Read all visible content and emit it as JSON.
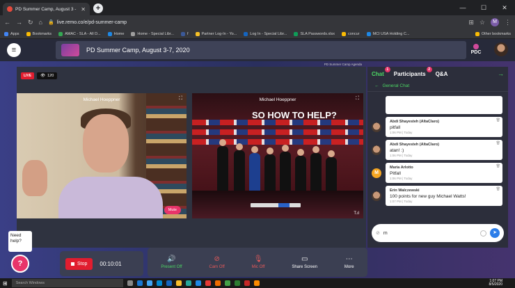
{
  "browser": {
    "tab_title": "PD Summer Camp, August 3 -",
    "url": "live.remo.co/e/pd-summer-camp",
    "bookmarks": [
      "Apps",
      "Bookmarks",
      "AMAC - SLA - All D...",
      "Home",
      "Home - Special Libr...",
      "f",
      "Partner Log-In - Yo...",
      "Log In - Special Libr...",
      "SLA Passwords.xlsx",
      "concur",
      "MCI USA Holding C..."
    ],
    "other_bookmarks": "Other bookmarks",
    "profile_initial": "M"
  },
  "header": {
    "event_title": "PD Summer Camp, August 3-7, 2020",
    "logo_text": "PDC",
    "agenda_label": "PD Summer Camp Agenda"
  },
  "stage": {
    "live_label": "LIVE",
    "viewer_count": "120",
    "tiles": [
      {
        "name": "Michael Hoeppner",
        "mute_label": "Mute"
      },
      {
        "name": "Michael Hoeppner",
        "slide_text": "SO HOW TO HELP?"
      }
    ]
  },
  "chat": {
    "tabs": [
      {
        "label": "Chat",
        "badge": "1"
      },
      {
        "label": "Participants",
        "badge": "2"
      },
      {
        "label": "Q&A",
        "badge": ""
      }
    ],
    "room": "General Chat",
    "messages": [
      {
        "author": "Abdi Shayesteh (AltaClaro)",
        "text": "pitfall",
        "time": "1:06 PM | Today",
        "avatar": "photo"
      },
      {
        "author": "Abdi Shayesteh (AltaClaro)",
        "text": "atan! :)",
        "time": "1:06 PM | Today",
        "avatar": "photo"
      },
      {
        "author": "Maria Arlotto",
        "text": "Pitfall",
        "time": "1:06 PM | Today",
        "avatar": "M"
      },
      {
        "author": "Erin Walczewski",
        "text": "100 points for new guy Michael Watts!",
        "time": "1:07 PM | Today",
        "avatar": "photo"
      }
    ],
    "input_value": "m"
  },
  "toolbar": {
    "need_help": "Need help?",
    "stop_label": "Stop",
    "timer": "00:10:01",
    "tools": [
      {
        "label": "Present Off",
        "icon": "present-icon"
      },
      {
        "label": "Cam Off",
        "icon": "camera-off-icon"
      },
      {
        "label": "Mic Off",
        "icon": "mic-off-icon"
      },
      {
        "label": "Share Screen",
        "icon": "share-screen-icon"
      },
      {
        "label": "More",
        "icon": "more-icon"
      }
    ]
  },
  "taskbar": {
    "search_placeholder": "Search Windows",
    "time": "1:07 PM",
    "date": "8/5/2020"
  }
}
